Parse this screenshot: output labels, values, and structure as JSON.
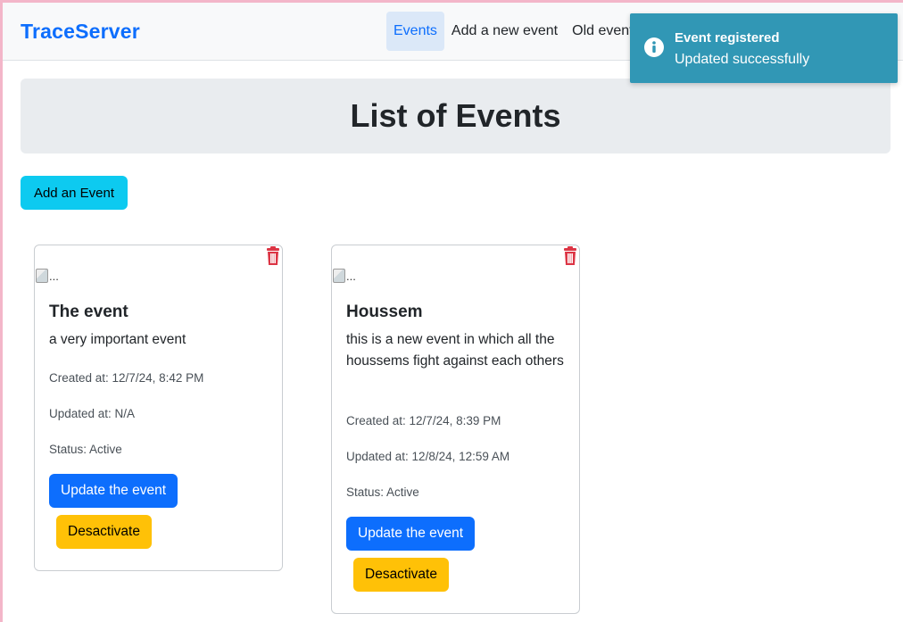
{
  "navbar": {
    "brand": "TraceServer",
    "links": [
      {
        "label": "Events",
        "active": true
      },
      {
        "label": "Add a new event",
        "active": false
      },
      {
        "label": "Old event",
        "active": false
      }
    ]
  },
  "hero": {
    "title": "List of Events"
  },
  "add_button": "Add an Event",
  "cards": [
    {
      "image_alt": "...",
      "title": "The event",
      "description": "a very important event",
      "created": "Created at: 12/7/24, 8:42 PM",
      "updated": "Updated at: N/A",
      "status": "Status: Active",
      "update_label": "Update the event",
      "deactivate_label": "Desactivate"
    },
    {
      "image_alt": "...",
      "title": "Houssem",
      "description": "this is a new event in which all the houssems fight against each others",
      "created": "Created at: 12/7/24, 8:39 PM",
      "updated": "Updated at: 12/8/24, 12:59 AM",
      "status": "Status: Active",
      "update_label": "Update the event",
      "deactivate_label": "Desactivate"
    }
  ],
  "toast": {
    "icon": "info-icon",
    "title": "Event registered",
    "message": "Updated successfully"
  },
  "colors": {
    "primary": "#0d6efd",
    "info": "#0dcaf0",
    "warning": "#ffc107",
    "danger": "#dc3545",
    "toast_bg": "#3197b5"
  }
}
